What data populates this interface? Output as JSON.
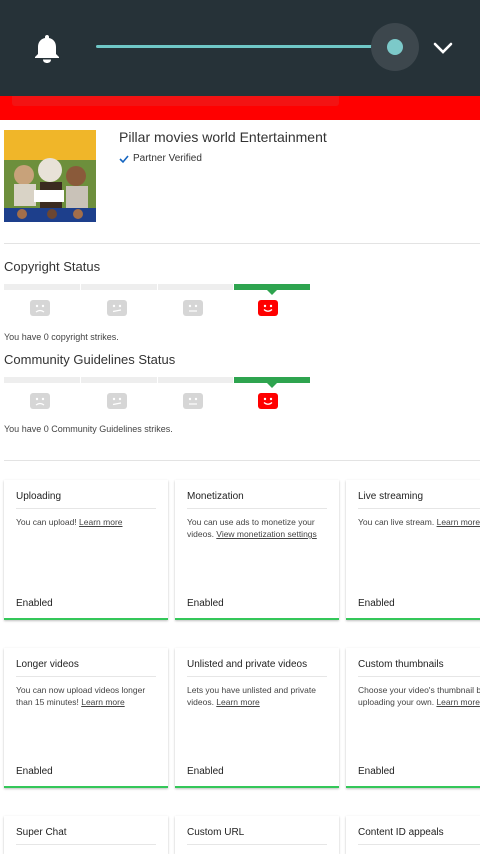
{
  "topbar": {
    "bell_icon": "bell-icon",
    "expand_icon": "chevron-down-icon",
    "slider_level": 1.0
  },
  "channel": {
    "name": "Pillar movies world Entertainment",
    "verified_label": "Partner Verified",
    "thumb_text_top": "WORLD ENTERTAINMENT",
    "thumb_text_mid": "THE GREATEST MUSTARD"
  },
  "copyright": {
    "title": "Copyright Status",
    "text": "You have 0 copyright strikes.",
    "active_segment": 4
  },
  "community": {
    "title": "Community Guidelines Status",
    "text": "You have 0 Community Guidelines strikes.",
    "active_segment": 4
  },
  "colors": {
    "accent_green": "#34c759",
    "brand_red": "#ff0000",
    "topbar": "#263238"
  },
  "cards": [
    {
      "title": "Uploading",
      "desc": "You can upload! ",
      "link": "Learn more",
      "status": "Enabled"
    },
    {
      "title": "Monetization",
      "desc": "You can use ads to monetize your videos. ",
      "link": "View monetization settings",
      "status": "Enabled"
    },
    {
      "title": "Live streaming",
      "desc": "You can live stream. ",
      "link": "Learn more",
      "status": "Enabled"
    },
    {
      "title": "Longer videos",
      "desc": "You can now upload videos longer than 15 minutes! ",
      "link": "Learn more",
      "status": "Enabled"
    },
    {
      "title": "Unlisted and private videos",
      "desc": "Lets you have unlisted and private videos. ",
      "link": "Learn more",
      "status": "Enabled"
    },
    {
      "title": "Custom thumbnails",
      "desc": "Choose your video's thumbnail by uploading your own. ",
      "link": "Learn more",
      "status": "Enabled"
    },
    {
      "title": "Super Chat",
      "desc": "",
      "link": "",
      "status": ""
    },
    {
      "title": "Custom URL",
      "desc": "",
      "link": "",
      "status": ""
    },
    {
      "title": "Content ID appeals",
      "desc": "",
      "link": "",
      "status": ""
    }
  ]
}
